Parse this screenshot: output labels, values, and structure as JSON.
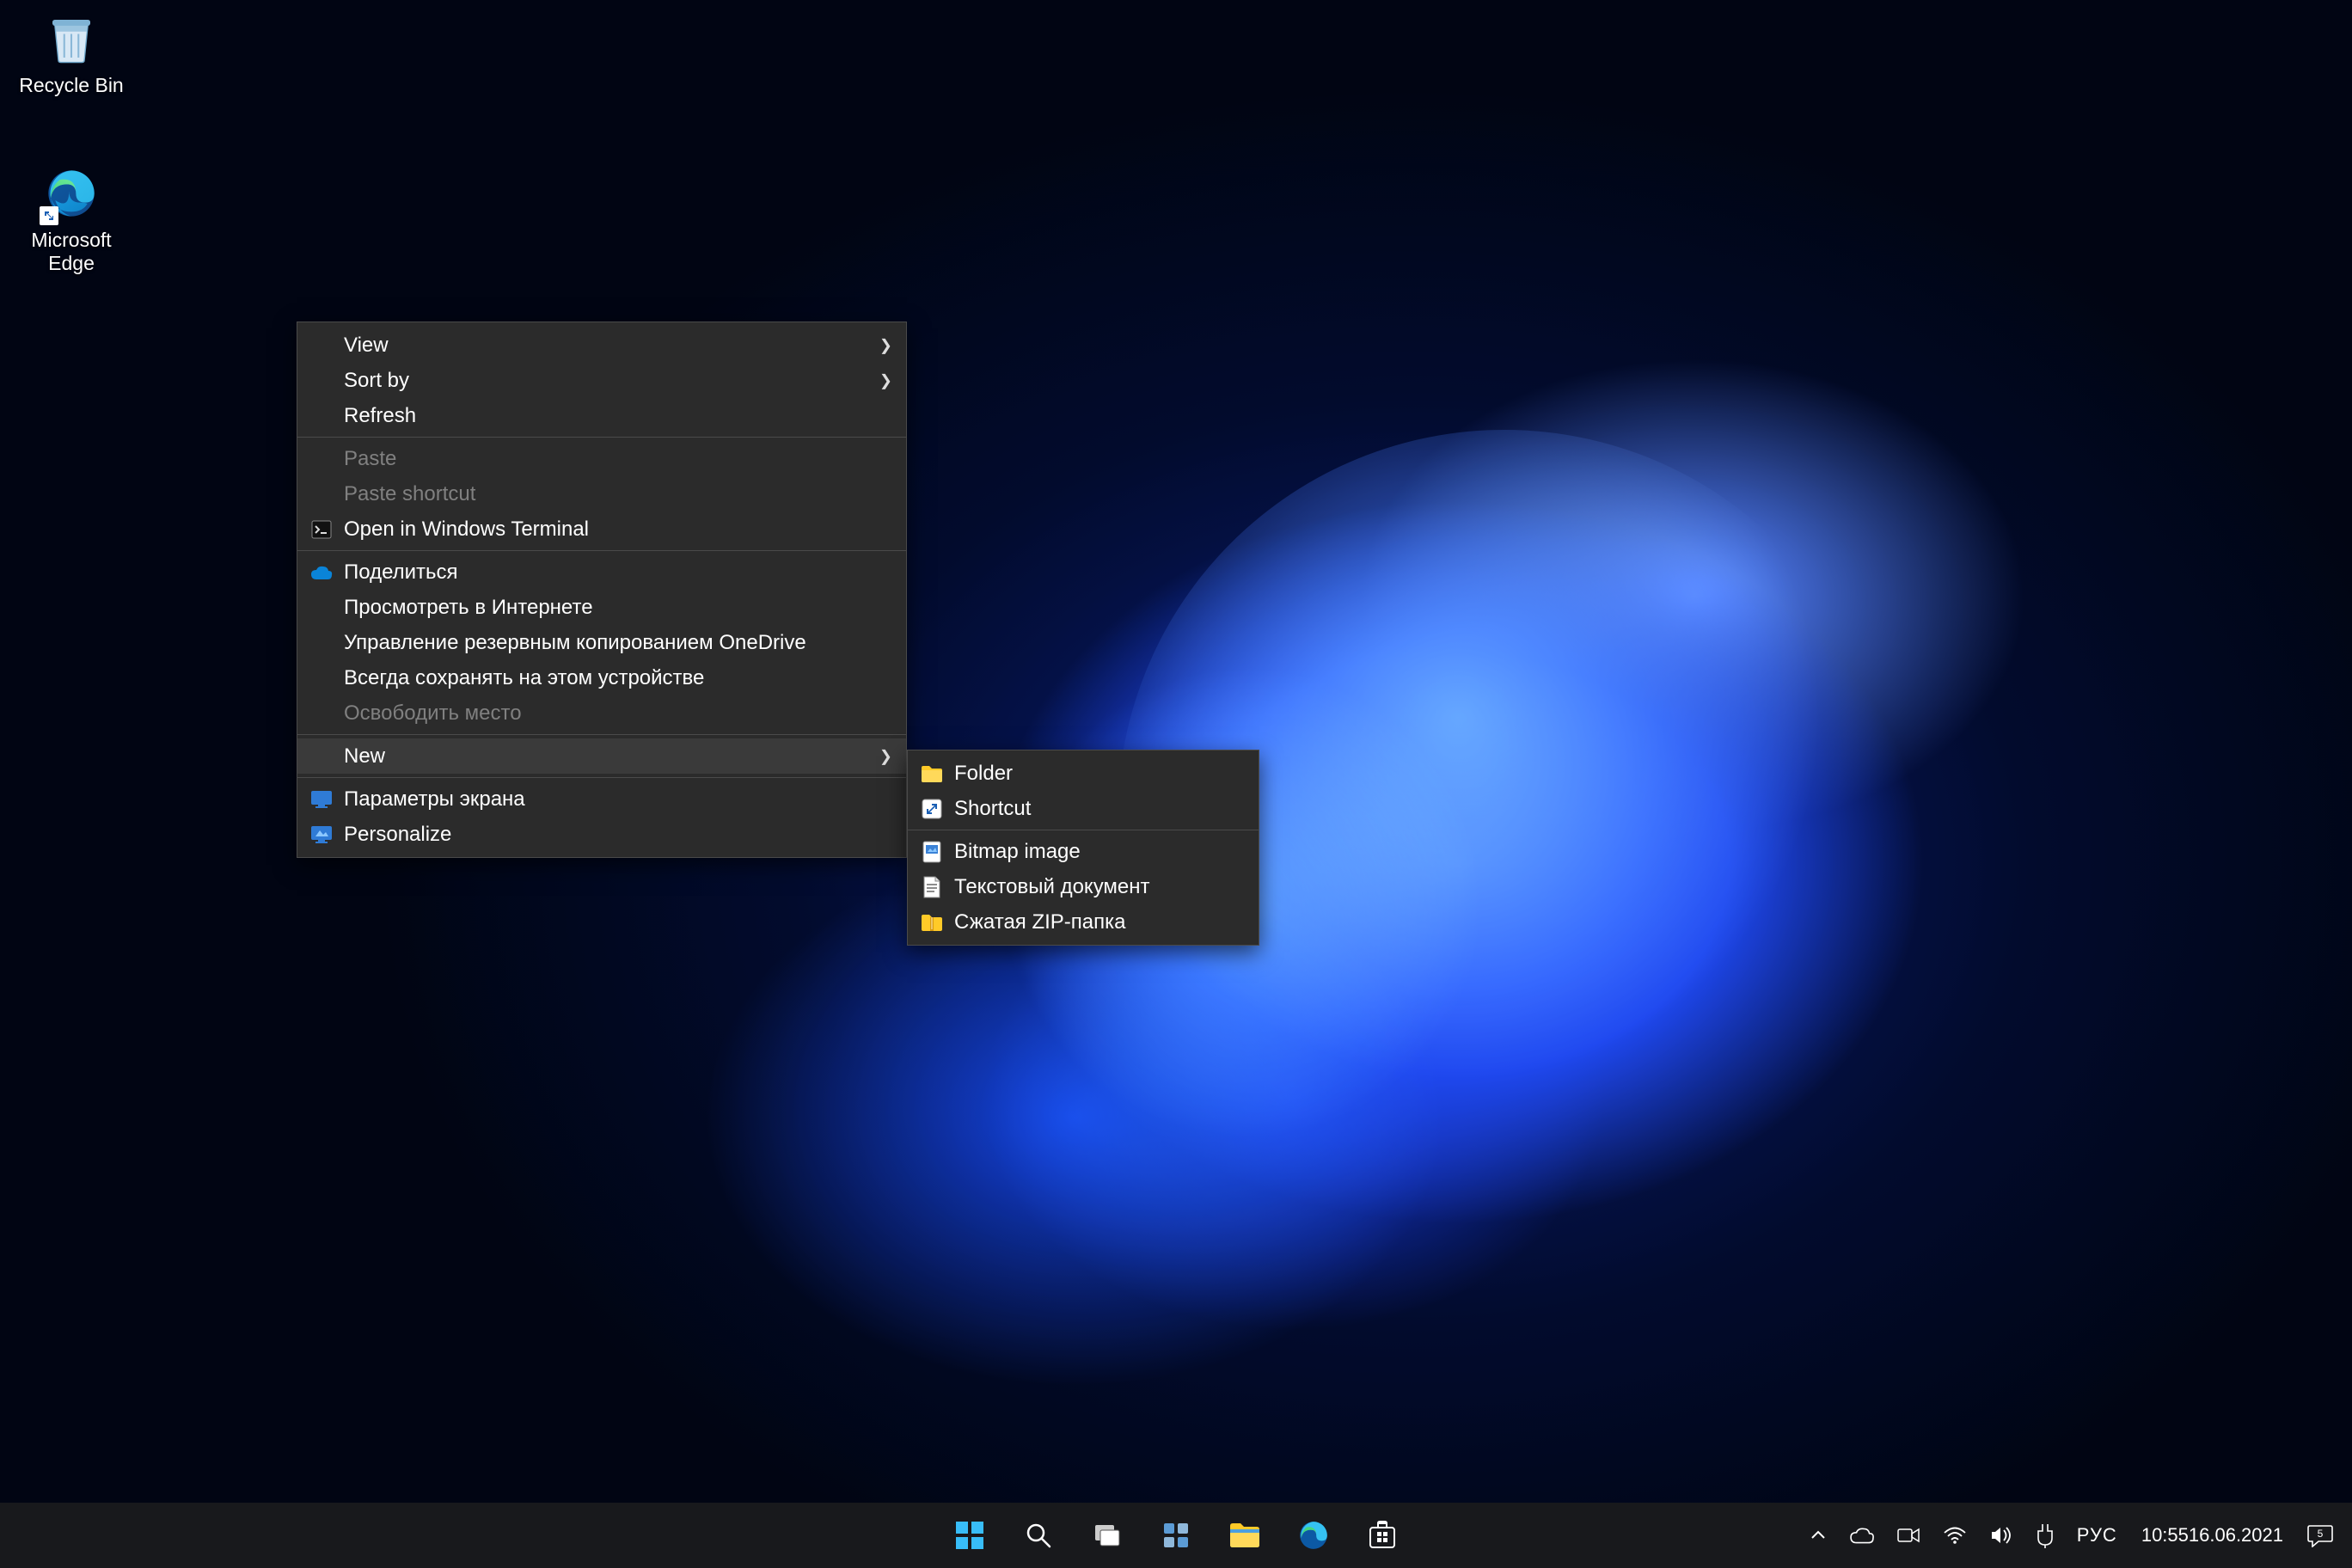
{
  "desktop": {
    "icons": {
      "recycle_bin": {
        "label": "Recycle Bin"
      },
      "edge": {
        "label": "Microsoft Edge"
      }
    }
  },
  "context_menu": {
    "view": "View",
    "sort_by": "Sort by",
    "refresh": "Refresh",
    "paste": "Paste",
    "paste_shortcut": "Paste shortcut",
    "open_terminal": "Open in Windows Terminal",
    "share": "Поделиться",
    "view_online": "Просмотреть в Интернете",
    "manage_backup": "Управление резервным копированием OneDrive",
    "always_keep": "Всегда сохранять на этом устройстве",
    "free_space": "Освободить место",
    "new": "New",
    "display_settings": "Параметры экрана",
    "personalize": "Personalize"
  },
  "new_submenu": {
    "folder": "Folder",
    "shortcut": "Shortcut",
    "bitmap": "Bitmap image",
    "text_doc": "Текстовый документ",
    "zip": "Сжатая ZIP-папка"
  },
  "taskbar": {
    "tray": {
      "language": "РУС",
      "time": "10:55",
      "date": "16.06.2021",
      "notification_count": "5"
    }
  }
}
